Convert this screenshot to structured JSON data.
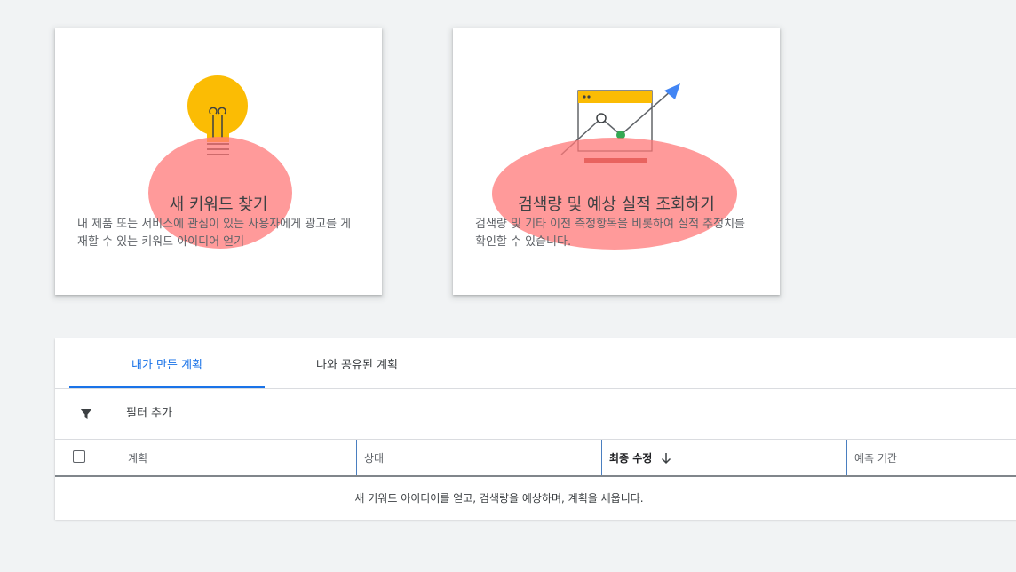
{
  "cards": [
    {
      "title": "새 키워드 찾기",
      "description": "내 제품 또는 서비스에 관심이 있는 사용자에게 광고를 게재할 수 있는 키워드 아이디어 얻기",
      "icon": "lightbulb-icon"
    },
    {
      "title": "검색량 및 예상 실적 조회하기",
      "description": "검색량 및 기타 이전 측정항목을 비롯하여 실적 추정치를 확인할 수 있습니다.",
      "icon": "forecast-chart-icon"
    }
  ],
  "plans": {
    "tabs": [
      {
        "label": "내가 만든 계획",
        "selected": true
      },
      {
        "label": "나와 공유된 계획",
        "selected": false
      }
    ],
    "filter": {
      "label": "필터 추가",
      "icon": "filter-icon"
    },
    "columns": {
      "plan": "계획",
      "status": "상태",
      "modified": "최종 수정",
      "forecast": "예측 기간"
    },
    "sort_icon": "arrow-down-icon",
    "empty_message": "새 키워드 아이디어를 얻고, 검색량을 예상하며, 계획을 세웁니다."
  },
  "colors": {
    "accent": "#1a73e8",
    "background": "#f1f3f4",
    "bulb_yellow": "#fbbc04",
    "arrow_blue": "#4285f4",
    "chart_green": "#34a853",
    "highlight": "#ff7878"
  }
}
